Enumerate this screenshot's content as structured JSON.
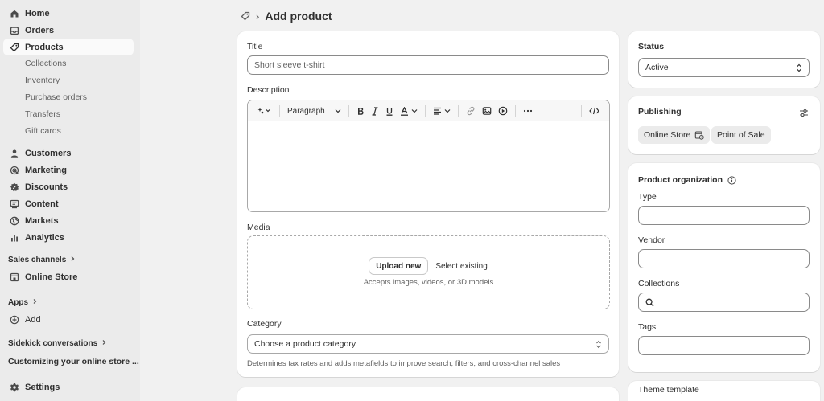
{
  "sidebar": {
    "primary": [
      {
        "label": "Home",
        "icon": "home-icon"
      },
      {
        "label": "Orders",
        "icon": "inbox-icon"
      },
      {
        "label": "Products",
        "icon": "tag-icon"
      }
    ],
    "products_sub": [
      "Collections",
      "Inventory",
      "Purchase orders",
      "Transfers",
      "Gift cards"
    ],
    "secondary": [
      {
        "label": "Customers",
        "icon": "person-icon"
      },
      {
        "label": "Marketing",
        "icon": "target-icon"
      },
      {
        "label": "Discounts",
        "icon": "discount-icon"
      },
      {
        "label": "Content",
        "icon": "content-icon"
      },
      {
        "label": "Markets",
        "icon": "globe-icon"
      },
      {
        "label": "Analytics",
        "icon": "bar-chart-icon"
      }
    ],
    "sales_channels_label": "Sales channels",
    "online_store_label": "Online Store",
    "apps_label": "Apps",
    "add_label": "Add",
    "sidekick_label": "Sidekick conversations",
    "conversation_label": "Customizing your online store ...",
    "settings_label": "Settings"
  },
  "header": {
    "title": "Add product"
  },
  "main": {
    "title_label": "Title",
    "title_placeholder": "Short sleeve t-shirt",
    "description_label": "Description",
    "toolbar": {
      "paragraph_label": "Paragraph"
    },
    "media_label": "Media",
    "upload_new_label": "Upload new",
    "select_existing_label": "Select existing",
    "media_help": "Accepts images, videos, or 3D models",
    "category_label": "Category",
    "category_placeholder": "Choose a product category",
    "category_help": "Determines tax rates and adds metafields to improve search, filters, and cross-channel sales"
  },
  "status": {
    "label": "Status",
    "value": "Active"
  },
  "publishing": {
    "label": "Publishing",
    "channels": [
      "Online Store",
      "Point of Sale"
    ]
  },
  "organization": {
    "label": "Product organization",
    "type_label": "Type",
    "vendor_label": "Vendor",
    "collections_label": "Collections",
    "tags_label": "Tags"
  },
  "theme_template": {
    "label": "Theme template"
  },
  "colors": {
    "page_bg": "#f1f1f1",
    "sidebar_bg": "#ebebeb",
    "card_bg": "#ffffff",
    "text": "#303030",
    "muted_text": "#616161"
  }
}
